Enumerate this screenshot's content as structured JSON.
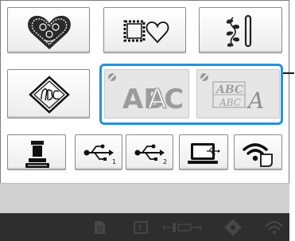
{
  "screen": "Embroidery machine pattern type selection",
  "rows": {
    "row1": [
      {
        "name": "embroidery-patterns",
        "icon": "decorative-heart-icon"
      },
      {
        "name": "frame-patterns",
        "icon": "stamp-frame-heart-icon"
      },
      {
        "name": "utility-embroidery",
        "icon": "vine-bar-icon"
      }
    ],
    "row2": [
      {
        "name": "monogram",
        "icon": "monogram-diamond-icon"
      },
      {
        "name": "alphabet-fonts",
        "icon": "alphabet-AA-icon",
        "letters": [
          "A",
          "A"
        ],
        "enabled": false
      },
      {
        "name": "decorative-alphabet",
        "icon": "decorative-alphabet-icon",
        "letters": [
          "ABC",
          "A"
        ],
        "enabled": false
      }
    ],
    "row3": [
      {
        "name": "pocket",
        "icon": "memory-chess-icon"
      },
      {
        "name": "usb-port-1",
        "icon": "usb-icon",
        "index": "1"
      },
      {
        "name": "usb-port-2",
        "icon": "usb-icon",
        "index": "2"
      },
      {
        "name": "computer",
        "icon": "computer-usb-icon"
      },
      {
        "name": "wireless",
        "icon": "wifi-device-icon"
      }
    ]
  },
  "colors": {
    "selection": "#2492dc",
    "bottom_bar": "#2e2e2e",
    "bottom_icons": "#474747"
  }
}
